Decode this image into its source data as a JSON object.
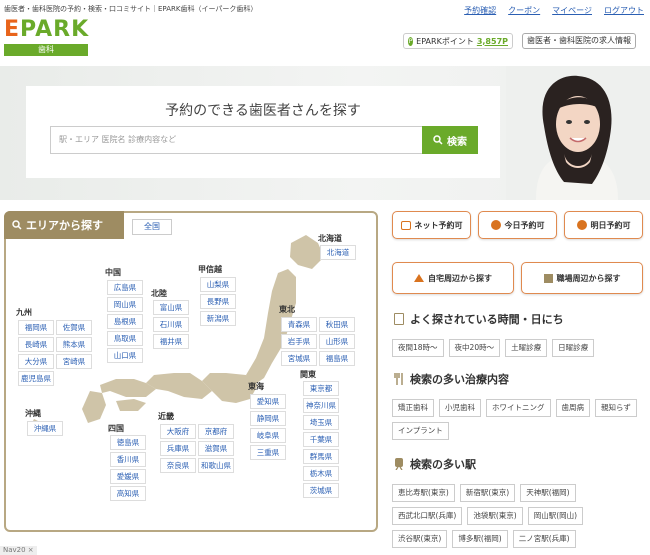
{
  "header": {
    "tagline": "歯医者・歯科医院の予約・検索・口コミサイト｜EPARK歯科（イーパーク歯科）",
    "links": [
      "予約確認",
      "クーポン",
      "マイページ",
      "ログアウト"
    ],
    "logo_main": "EPARK",
    "logo_sub": "歯科",
    "points_label": "EPARKポイント",
    "points_value": "3,857P",
    "recruit_label": "歯医者・歯科医院の求人情報"
  },
  "hero": {
    "title": "予約のできる歯医者さんを探す",
    "search_placeholder": "駅・エリア 医院名 診療内容など",
    "search_button": "検索"
  },
  "area": {
    "tab_label": "エリアから探す",
    "zenkoku": "全国",
    "regions": {
      "hokkaido": {
        "name": "北海道",
        "prefs": [
          "北海道"
        ]
      },
      "tohoku": {
        "name": "東北",
        "prefs": [
          "青森県",
          "秋田県",
          "岩手県",
          "山形県",
          "宮城県",
          "福島県"
        ]
      },
      "koshinetsu": {
        "name": "甲信越",
        "prefs": [
          "山梨県",
          "長野県",
          "新潟県"
        ]
      },
      "hokuriku": {
        "name": "北陸",
        "prefs": [
          "富山県",
          "石川県",
          "福井県"
        ]
      },
      "kanto": {
        "name": "関東",
        "prefs": [
          "東京都",
          "神奈川県",
          "埼玉県",
          "千葉県",
          "群馬県",
          "栃木県",
          "茨城県"
        ]
      },
      "tokai": {
        "name": "東海",
        "prefs": [
          "愛知県",
          "静岡県",
          "岐阜県",
          "三重県"
        ]
      },
      "kinki": {
        "name": "近畿",
        "prefs": [
          "大阪府",
          "京都府",
          "兵庫県",
          "滋賀県",
          "奈良県",
          "和歌山県"
        ]
      },
      "chugoku": {
        "name": "中国",
        "prefs": [
          "広島県",
          "岡山県",
          "島根県",
          "鳥取県",
          "山口県"
        ]
      },
      "shikoku": {
        "name": "四国",
        "prefs": [
          "徳島県",
          "香川県",
          "愛媛県",
          "高知県"
        ]
      },
      "kyushu": {
        "name": "九州",
        "prefs": [
          "福岡県",
          "佐賀県",
          "長崎県",
          "熊本県",
          "大分県",
          "宮崎県",
          "鹿児島県"
        ]
      },
      "okinawa": {
        "name": "沖縄",
        "prefs": [
          "沖縄県"
        ]
      }
    }
  },
  "reserve_buttons": [
    "ネット予約可",
    "今日予約可",
    "明日予約可"
  ],
  "near_buttons": [
    "自宅周辺から探す",
    "職場周辺から探す"
  ],
  "time_section": {
    "title": "よく探されている時間・日にち",
    "chips": [
      "夜間18時〜",
      "夜中20時〜",
      "土曜診療",
      "日曜診療"
    ]
  },
  "treatment_section": {
    "title": "検索の多い治療内容",
    "chips": [
      "矯正歯科",
      "小児歯科",
      "ホワイトニング",
      "歯周病",
      "親知らず",
      "インプラント"
    ]
  },
  "station_section": {
    "title": "検索の多い駅",
    "chips": [
      "恵比寿駅(東京)",
      "新宿駅(東京)",
      "天神駅(福岡)",
      "西武北口駅(兵庫)",
      "池袋駅(東京)",
      "岡山駅(岡山)",
      "渋谷駅(東京)",
      "博多駅(福岡)",
      "二ノ宮駅(兵庫)"
    ]
  },
  "footer": {
    "tag": "Nav20 ×"
  },
  "colors": {
    "brand_green": "#6aaa2a",
    "accent_orange": "#d9731f",
    "area_brown": "#9e8c62",
    "link_blue": "#2b5fb3"
  }
}
